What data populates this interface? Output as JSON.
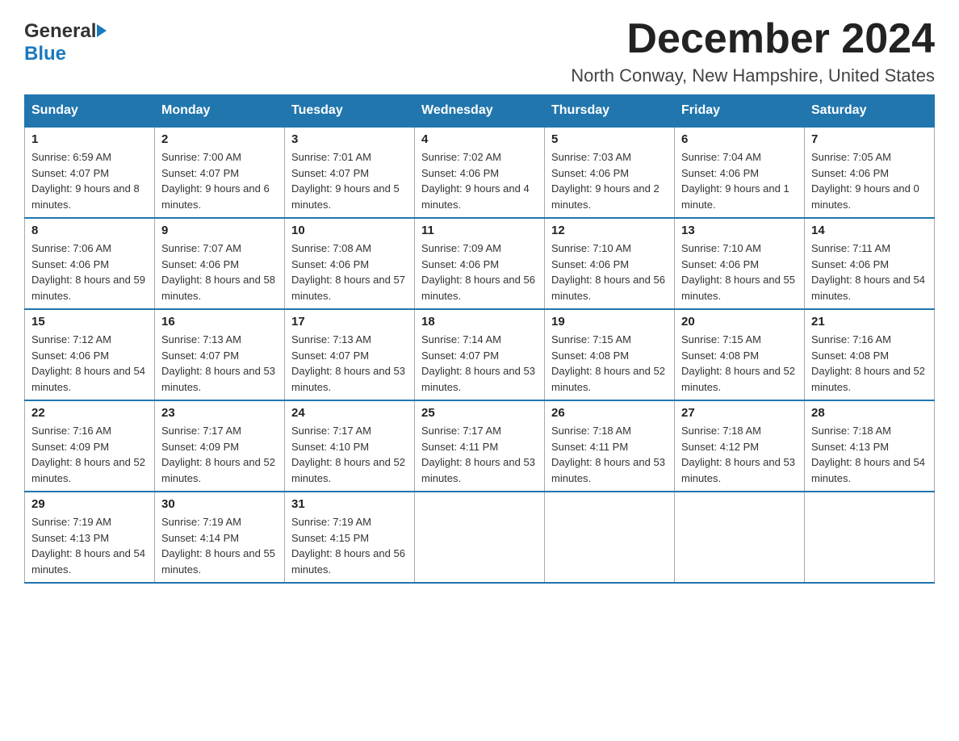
{
  "header": {
    "logo_general": "General",
    "logo_blue": "Blue",
    "month_title": "December 2024",
    "location": "North Conway, New Hampshire, United States"
  },
  "weekdays": [
    "Sunday",
    "Monday",
    "Tuesday",
    "Wednesday",
    "Thursday",
    "Friday",
    "Saturday"
  ],
  "weeks": [
    [
      {
        "day": "1",
        "sunrise": "Sunrise: 6:59 AM",
        "sunset": "Sunset: 4:07 PM",
        "daylight": "Daylight: 9 hours and 8 minutes."
      },
      {
        "day": "2",
        "sunrise": "Sunrise: 7:00 AM",
        "sunset": "Sunset: 4:07 PM",
        "daylight": "Daylight: 9 hours and 6 minutes."
      },
      {
        "day": "3",
        "sunrise": "Sunrise: 7:01 AM",
        "sunset": "Sunset: 4:07 PM",
        "daylight": "Daylight: 9 hours and 5 minutes."
      },
      {
        "day": "4",
        "sunrise": "Sunrise: 7:02 AM",
        "sunset": "Sunset: 4:06 PM",
        "daylight": "Daylight: 9 hours and 4 minutes."
      },
      {
        "day": "5",
        "sunrise": "Sunrise: 7:03 AM",
        "sunset": "Sunset: 4:06 PM",
        "daylight": "Daylight: 9 hours and 2 minutes."
      },
      {
        "day": "6",
        "sunrise": "Sunrise: 7:04 AM",
        "sunset": "Sunset: 4:06 PM",
        "daylight": "Daylight: 9 hours and 1 minute."
      },
      {
        "day": "7",
        "sunrise": "Sunrise: 7:05 AM",
        "sunset": "Sunset: 4:06 PM",
        "daylight": "Daylight: 9 hours and 0 minutes."
      }
    ],
    [
      {
        "day": "8",
        "sunrise": "Sunrise: 7:06 AM",
        "sunset": "Sunset: 4:06 PM",
        "daylight": "Daylight: 8 hours and 59 minutes."
      },
      {
        "day": "9",
        "sunrise": "Sunrise: 7:07 AM",
        "sunset": "Sunset: 4:06 PM",
        "daylight": "Daylight: 8 hours and 58 minutes."
      },
      {
        "day": "10",
        "sunrise": "Sunrise: 7:08 AM",
        "sunset": "Sunset: 4:06 PM",
        "daylight": "Daylight: 8 hours and 57 minutes."
      },
      {
        "day": "11",
        "sunrise": "Sunrise: 7:09 AM",
        "sunset": "Sunset: 4:06 PM",
        "daylight": "Daylight: 8 hours and 56 minutes."
      },
      {
        "day": "12",
        "sunrise": "Sunrise: 7:10 AM",
        "sunset": "Sunset: 4:06 PM",
        "daylight": "Daylight: 8 hours and 56 minutes."
      },
      {
        "day": "13",
        "sunrise": "Sunrise: 7:10 AM",
        "sunset": "Sunset: 4:06 PM",
        "daylight": "Daylight: 8 hours and 55 minutes."
      },
      {
        "day": "14",
        "sunrise": "Sunrise: 7:11 AM",
        "sunset": "Sunset: 4:06 PM",
        "daylight": "Daylight: 8 hours and 54 minutes."
      }
    ],
    [
      {
        "day": "15",
        "sunrise": "Sunrise: 7:12 AM",
        "sunset": "Sunset: 4:06 PM",
        "daylight": "Daylight: 8 hours and 54 minutes."
      },
      {
        "day": "16",
        "sunrise": "Sunrise: 7:13 AM",
        "sunset": "Sunset: 4:07 PM",
        "daylight": "Daylight: 8 hours and 53 minutes."
      },
      {
        "day": "17",
        "sunrise": "Sunrise: 7:13 AM",
        "sunset": "Sunset: 4:07 PM",
        "daylight": "Daylight: 8 hours and 53 minutes."
      },
      {
        "day": "18",
        "sunrise": "Sunrise: 7:14 AM",
        "sunset": "Sunset: 4:07 PM",
        "daylight": "Daylight: 8 hours and 53 minutes."
      },
      {
        "day": "19",
        "sunrise": "Sunrise: 7:15 AM",
        "sunset": "Sunset: 4:08 PM",
        "daylight": "Daylight: 8 hours and 52 minutes."
      },
      {
        "day": "20",
        "sunrise": "Sunrise: 7:15 AM",
        "sunset": "Sunset: 4:08 PM",
        "daylight": "Daylight: 8 hours and 52 minutes."
      },
      {
        "day": "21",
        "sunrise": "Sunrise: 7:16 AM",
        "sunset": "Sunset: 4:08 PM",
        "daylight": "Daylight: 8 hours and 52 minutes."
      }
    ],
    [
      {
        "day": "22",
        "sunrise": "Sunrise: 7:16 AM",
        "sunset": "Sunset: 4:09 PM",
        "daylight": "Daylight: 8 hours and 52 minutes."
      },
      {
        "day": "23",
        "sunrise": "Sunrise: 7:17 AM",
        "sunset": "Sunset: 4:09 PM",
        "daylight": "Daylight: 8 hours and 52 minutes."
      },
      {
        "day": "24",
        "sunrise": "Sunrise: 7:17 AM",
        "sunset": "Sunset: 4:10 PM",
        "daylight": "Daylight: 8 hours and 52 minutes."
      },
      {
        "day": "25",
        "sunrise": "Sunrise: 7:17 AM",
        "sunset": "Sunset: 4:11 PM",
        "daylight": "Daylight: 8 hours and 53 minutes."
      },
      {
        "day": "26",
        "sunrise": "Sunrise: 7:18 AM",
        "sunset": "Sunset: 4:11 PM",
        "daylight": "Daylight: 8 hours and 53 minutes."
      },
      {
        "day": "27",
        "sunrise": "Sunrise: 7:18 AM",
        "sunset": "Sunset: 4:12 PM",
        "daylight": "Daylight: 8 hours and 53 minutes."
      },
      {
        "day": "28",
        "sunrise": "Sunrise: 7:18 AM",
        "sunset": "Sunset: 4:13 PM",
        "daylight": "Daylight: 8 hours and 54 minutes."
      }
    ],
    [
      {
        "day": "29",
        "sunrise": "Sunrise: 7:19 AM",
        "sunset": "Sunset: 4:13 PM",
        "daylight": "Daylight: 8 hours and 54 minutes."
      },
      {
        "day": "30",
        "sunrise": "Sunrise: 7:19 AM",
        "sunset": "Sunset: 4:14 PM",
        "daylight": "Daylight: 8 hours and 55 minutes."
      },
      {
        "day": "31",
        "sunrise": "Sunrise: 7:19 AM",
        "sunset": "Sunset: 4:15 PM",
        "daylight": "Daylight: 8 hours and 56 minutes."
      },
      null,
      null,
      null,
      null
    ]
  ]
}
